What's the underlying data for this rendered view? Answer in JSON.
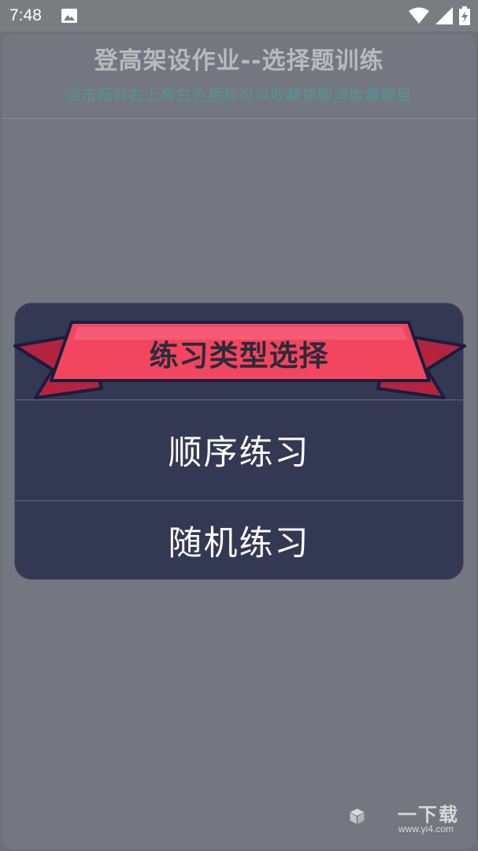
{
  "status_bar": {
    "time": "7:48",
    "icons": [
      "image-icon",
      "wifi-icon",
      "signal-icon",
      "battery-icon"
    ]
  },
  "header": {
    "title": "登高架设作业--选择题训练",
    "subtitle": "点击题目右上角白色星标可以收藏或取消收藏题目"
  },
  "dialog": {
    "title": "练习类型选择",
    "options": [
      "顺序练习",
      "随机练习"
    ],
    "ribbon_color": "#f2465f",
    "ribbon_dark": "#b4243f"
  },
  "watermark": {
    "text": "一下载",
    "url": "www.yi4.com"
  },
  "colors": {
    "dialog_bg": "#333853",
    "overlay_bg": "#74777f",
    "subtitle": "#50959a"
  }
}
